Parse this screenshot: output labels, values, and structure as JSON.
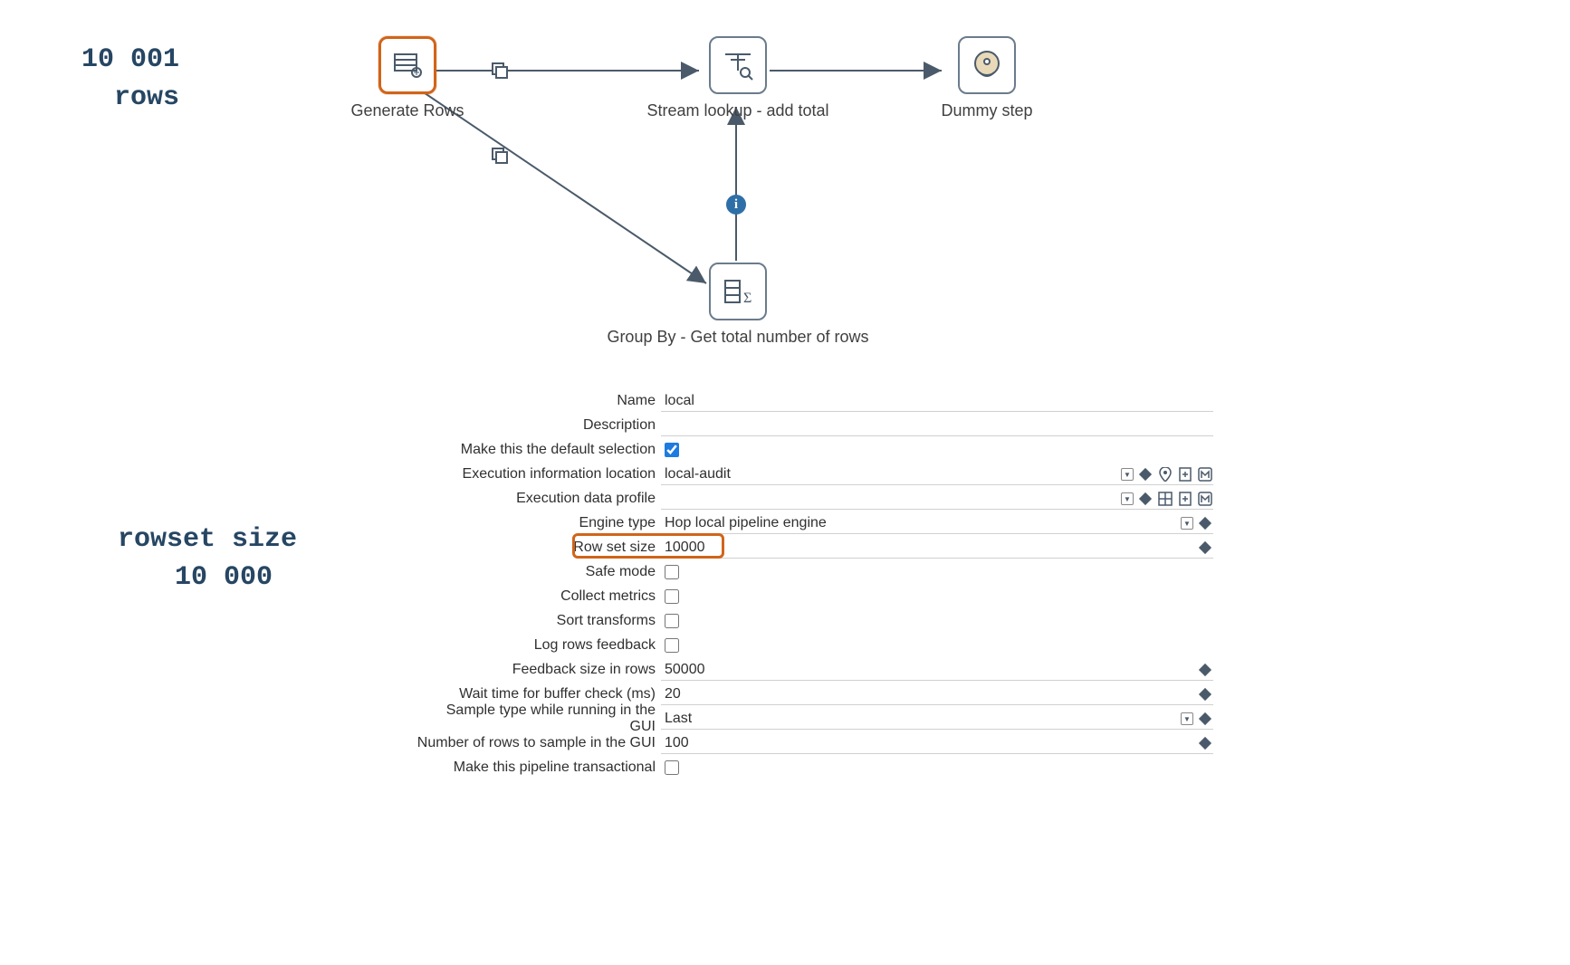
{
  "annotations": {
    "rows_count": "10 001\n  rows",
    "rowset_size": "rowset size\n  10 000"
  },
  "diagram": {
    "nodes": {
      "generate_rows": {
        "label": "Generate Rows"
      },
      "stream_lookup": {
        "label": "Stream lookup - add total"
      },
      "dummy_step": {
        "label": "Dummy step"
      },
      "group_by": {
        "label": "Group By - Get total number of rows"
      }
    }
  },
  "form": {
    "name": {
      "label": "Name",
      "value": "local"
    },
    "description": {
      "label": "Description",
      "value": ""
    },
    "default_selection": {
      "label": "Make this the default selection",
      "checked": true
    },
    "exec_info_location": {
      "label": "Execution information location",
      "value": "local-audit"
    },
    "exec_data_profile": {
      "label": "Execution data profile",
      "value": ""
    },
    "engine_type": {
      "label": "Engine type",
      "value": "Hop local pipeline engine"
    },
    "row_set_size": {
      "label": "Row set size",
      "value": "10000"
    },
    "safe_mode": {
      "label": "Safe mode",
      "checked": false
    },
    "collect_metrics": {
      "label": "Collect metrics",
      "checked": false
    },
    "sort_transforms": {
      "label": "Sort transforms",
      "checked": false
    },
    "log_rows_feedback": {
      "label": "Log rows feedback",
      "checked": false
    },
    "feedback_size": {
      "label": "Feedback size in rows",
      "value": "50000"
    },
    "wait_time": {
      "label": "Wait time for buffer check (ms)",
      "value": "20"
    },
    "sample_type": {
      "label": "Sample type while running in the GUI",
      "value": "Last"
    },
    "sample_rows": {
      "label": "Number of rows to sample in the GUI",
      "value": "100"
    },
    "transactional": {
      "label": "Make this pipeline transactional",
      "checked": false
    }
  }
}
